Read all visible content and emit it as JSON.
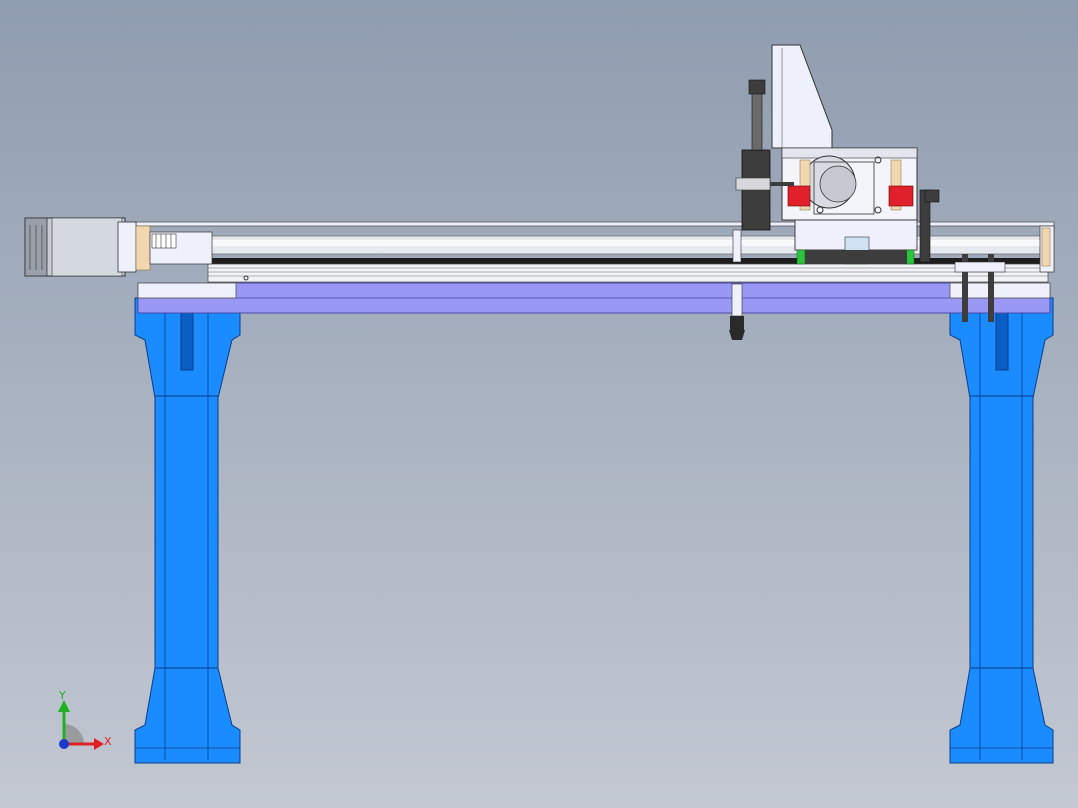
{
  "view": {
    "background_top": "#8f9db0",
    "background_bottom": "#c3c8d2"
  },
  "colors": {
    "frame_blue": "#1a8cff",
    "frame_blue_dark": "#0b5fc4",
    "frame_outline": "#0a3d8a",
    "beam_lavender": "#9a98f5",
    "plate_white": "#eef0fb",
    "rail_silver": "#d9dde4",
    "motor_grey": "#c8ccd4",
    "bearing_red": "#e0202a",
    "green_block": "#28c43a",
    "wood_spacer": "#f0d7b0",
    "dark_part": "#3d3d3d"
  },
  "triad": {
    "x_label": "X",
    "y_label": "Y",
    "x_color": "#e02020",
    "y_color": "#20b020",
    "origin_color": "#1a3acc"
  },
  "icons": {
    "axes": "coordinate-triad-icon"
  }
}
